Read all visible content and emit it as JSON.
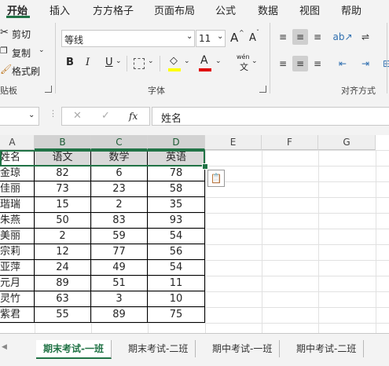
{
  "menu": {
    "tabs": [
      {
        "label": "开始",
        "active": true
      },
      {
        "label": "插入"
      },
      {
        "label": "方方格子"
      },
      {
        "label": "页面布局"
      },
      {
        "label": "公式"
      },
      {
        "label": "数据"
      },
      {
        "label": "视图"
      },
      {
        "label": "帮助"
      }
    ]
  },
  "ribbon": {
    "clipboard": {
      "cut": "剪切",
      "copy": "复制",
      "format_painter": "格式刷",
      "group": "贴板"
    },
    "font": {
      "name": "等线",
      "size": "11",
      "bold": "B",
      "italic": "I",
      "underline": "U",
      "grow": "A",
      "shrink": "A",
      "font_color_letter": "A",
      "phonetic": "wén",
      "phonetic_zh": "文",
      "group": "字体",
      "fill_color": "#ffff00",
      "font_color": "#e00000"
    },
    "alignment": {
      "group": "对齐方式"
    }
  },
  "formula_bar": {
    "fx": "fx",
    "value": "姓名"
  },
  "sheet": {
    "accent_color": "#217346",
    "columns": [
      "A",
      "B",
      "C",
      "D",
      "E",
      "F",
      "G"
    ],
    "rows": [
      [
        "姓名",
        "语文",
        "数学",
        "英语"
      ],
      [
        "金琼",
        "82",
        "6",
        "78"
      ],
      [
        "佳丽",
        "73",
        "23",
        "58"
      ],
      [
        "瑎瑞",
        "15",
        "2",
        "35"
      ],
      [
        "朱燕",
        "50",
        "83",
        "93"
      ],
      [
        "美丽",
        "2",
        "59",
        "54"
      ],
      [
        "宗莉",
        "12",
        "77",
        "56"
      ],
      [
        "亚萍",
        "24",
        "49",
        "54"
      ],
      [
        "元月",
        "89",
        "51",
        "11"
      ],
      [
        "灵竹",
        "63",
        "3",
        "10"
      ],
      [
        "紫君",
        "55",
        "89",
        "75"
      ]
    ]
  },
  "sheet_tabs": [
    {
      "label": "期末考试-一班",
      "active": true
    },
    {
      "label": "期末考试-二班"
    },
    {
      "label": "期中考试-一班"
    },
    {
      "label": "期中考试-二班"
    }
  ]
}
